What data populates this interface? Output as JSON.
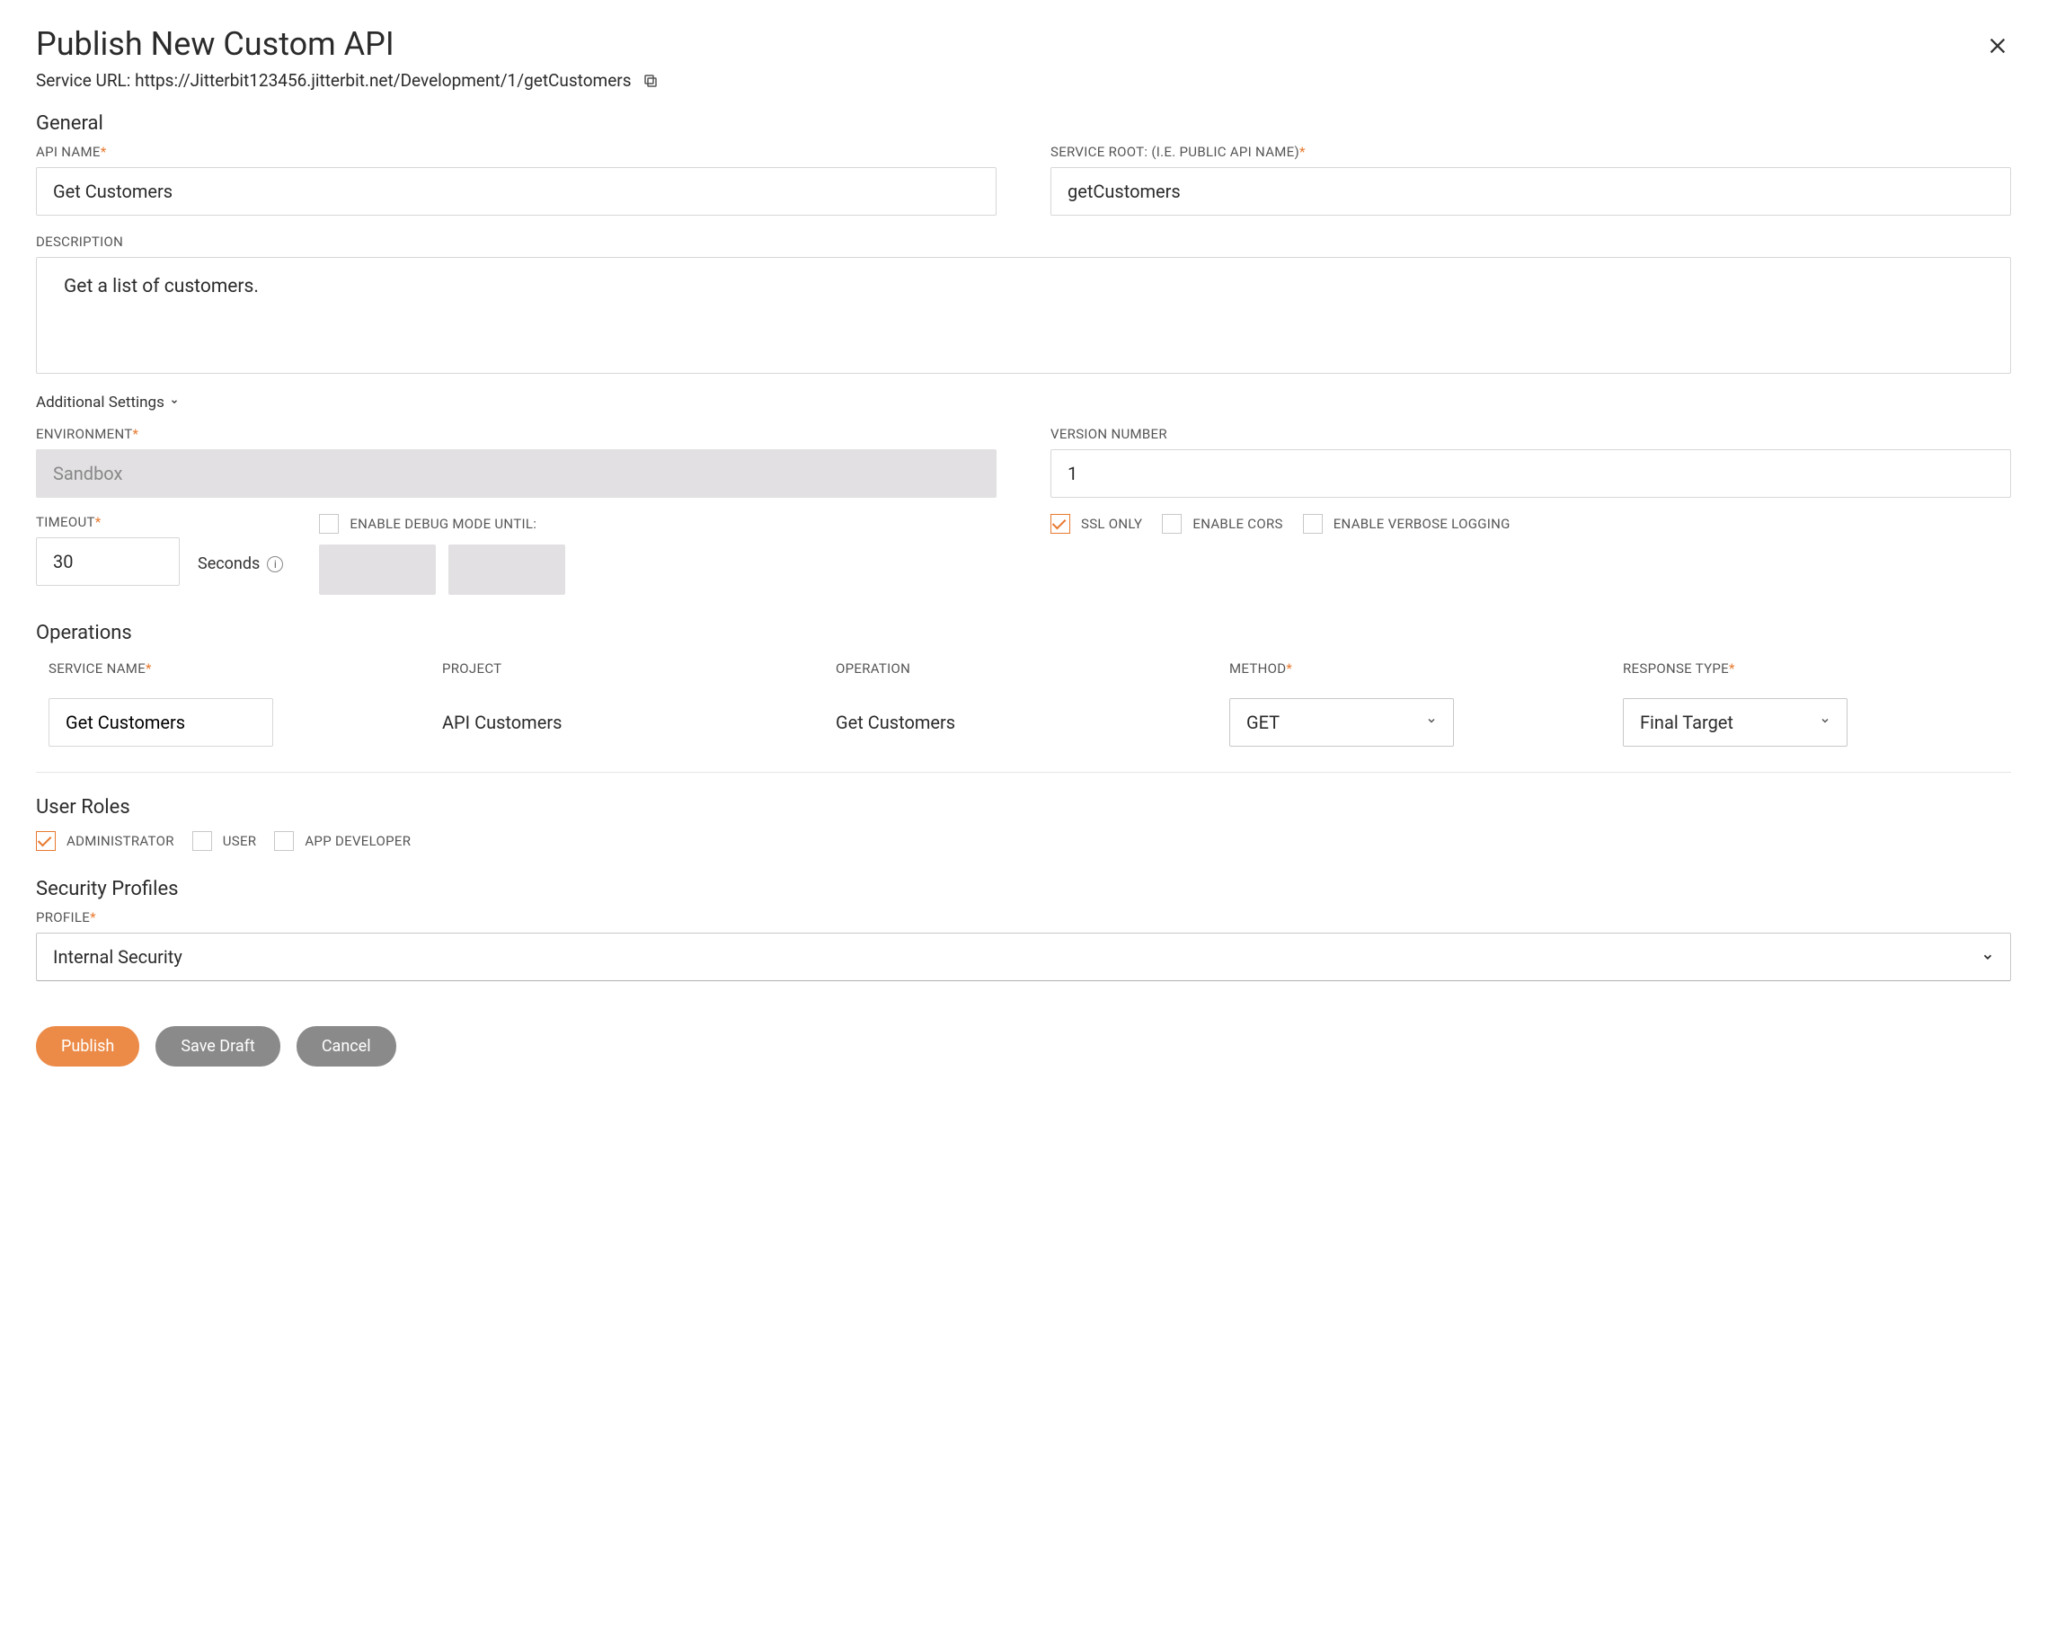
{
  "header": {
    "title": "Publish New Custom API",
    "service_url_label": "Service URL: ",
    "service_url": "https://Jitterbit123456.jitterbit.net/Development/1/getCustomers"
  },
  "general": {
    "heading": "General",
    "api_name_label": "API NAME",
    "api_name_value": "Get Customers",
    "service_root_label": "SERVICE ROOT: (I.E. PUBLIC API NAME)",
    "service_root_value": "getCustomers",
    "description_label": "DESCRIPTION",
    "description_value": "Get a list of customers."
  },
  "additional": {
    "toggle_label": "Additional Settings",
    "environment_label": "ENVIRONMENT",
    "environment_value": "Sandbox",
    "version_label": "VERSION NUMBER",
    "version_value": "1",
    "timeout_label": "TIMEOUT",
    "timeout_value": "30",
    "seconds_label": "Seconds",
    "debug_label": "ENABLE DEBUG MODE UNTIL:",
    "debug_checked": false,
    "ssl_label": "SSL ONLY",
    "ssl_checked": true,
    "cors_label": "ENABLE CORS",
    "cors_checked": false,
    "verbose_label": "ENABLE VERBOSE LOGGING",
    "verbose_checked": false
  },
  "operations": {
    "heading": "Operations",
    "columns": {
      "service_name": "SERVICE NAME",
      "project": "PROJECT",
      "operation": "OPERATION",
      "method": "METHOD",
      "response_type": "RESPONSE TYPE"
    },
    "row": {
      "service_name": "Get Customers",
      "project": "API Customers",
      "operation": "Get Customers",
      "method": "GET",
      "response_type": "Final Target"
    }
  },
  "user_roles": {
    "heading": "User Roles",
    "admin_label": "ADMINISTRATOR",
    "admin_checked": true,
    "user_label": "USER",
    "user_checked": false,
    "appdev_label": "APP DEVELOPER",
    "appdev_checked": false
  },
  "security": {
    "heading": "Security Profiles",
    "profile_label": "PROFILE",
    "profile_value": "Internal Security"
  },
  "footer": {
    "publish": "Publish",
    "save_draft": "Save Draft",
    "cancel": "Cancel"
  }
}
